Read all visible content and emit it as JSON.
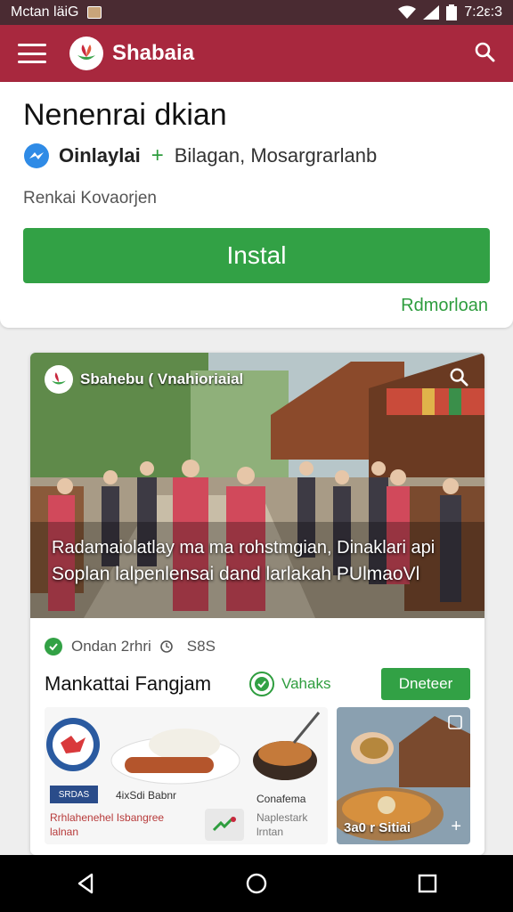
{
  "status_bar": {
    "carrier": "Mctan läiG",
    "time": "7:2ε:3",
    "icons": [
      "image-icon",
      "wifi-icon",
      "signal-icon",
      "battery-icon"
    ]
  },
  "app_bar": {
    "title": "Shabaia",
    "icons": [
      "menu-icon",
      "logo-icon",
      "search-icon"
    ]
  },
  "install_card": {
    "title": "Nenenrai dkian",
    "developer": "Oinlaylai",
    "plus": "+",
    "category": "Bilagan, Mosargrarlanb",
    "subtitle": "Renkai Kovaorjen",
    "install_label": "Instal",
    "link_label": "Rdmorloan"
  },
  "feed_card": {
    "hero_brand": "Sbahebu ( Vnahioriaial",
    "hero_caption_line1": "Radamaiolatlay ma ma rohstmgian, Dinaklari api",
    "hero_caption_line2": "Soplan lalpenlensai dand larlakah PUlmaoVl",
    "meta_text": "Ondan 2rhri",
    "meta_extra": "S8S",
    "title": "Mankattai Fangjam",
    "verified_label": "Vahaks",
    "action_label": "Dneteer",
    "promo_box": "SRDAS",
    "promo_text_1": "4ixSdi Babnr",
    "promo_text_2": "Conafema",
    "promo_text_3": "Rrhlahenehel Isbangree lalnan",
    "promo_text_4": "Naplestark lrntan",
    "photo_caption": "3a0 r Sitiai",
    "photo_plus": "+"
  },
  "colors": {
    "status_bar": "#4a2b32",
    "app_bar": "#a8283e",
    "accent_green": "#32a145",
    "nav_bar": "#000000"
  },
  "nav_bar": {
    "icons": [
      "back-icon",
      "home-icon",
      "recents-icon"
    ]
  }
}
